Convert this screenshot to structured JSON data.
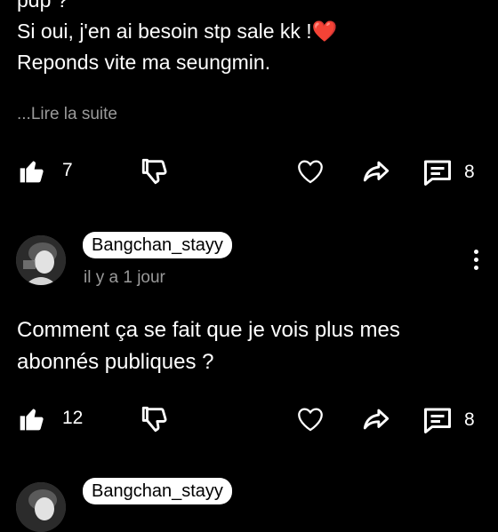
{
  "post1": {
    "lines": [
      "pdp ?",
      "Si oui, j'en ai besoin stp sale kk !",
      "Reponds vite ma seungmin."
    ],
    "heart_emoji": "❤️",
    "read_more": "...Lire la suite",
    "likes": "7",
    "replies": "8"
  },
  "post2": {
    "username": "Bangchan_stayy",
    "time": "il y a 1 jour",
    "lines": [
      "Comment ça se fait que je vois plus mes",
      "abonnés publiques ?"
    ],
    "likes": "12",
    "replies": "8"
  },
  "post3": {
    "username": "Bangchan_stayy"
  },
  "icons": {
    "like": "thumbs-up-icon",
    "dislike": "thumbs-down-icon",
    "heart": "heart-icon",
    "share": "share-icon",
    "reply": "comment-icon",
    "more": "more-vertical-icon"
  },
  "colors": {
    "background": "#000000",
    "text": "#ffffff",
    "muted": "#9a9a9a",
    "emoji_heart": "#e8232f"
  }
}
